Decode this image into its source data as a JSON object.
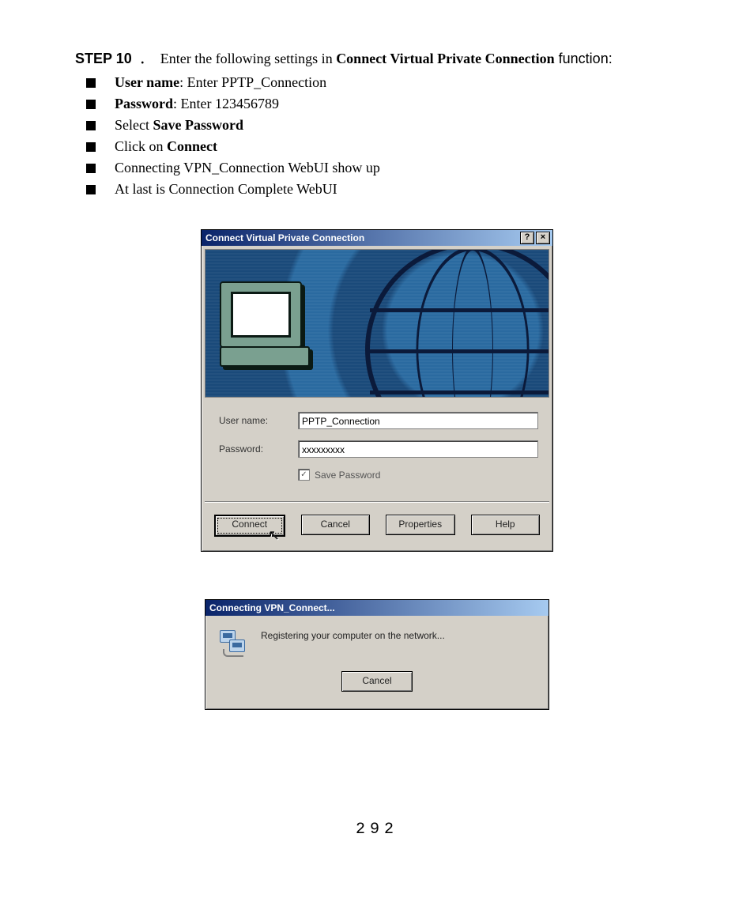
{
  "step": {
    "label": "STEP 10",
    "dot": "﹒",
    "intro_before": "Enter the following settings in ",
    "intro_bold": "Connect Virtual Private Connection",
    "intro_after": " function:"
  },
  "bullets": [
    {
      "pre_bold": "User name",
      "pre_rest": ": Enter PPTP_Connection"
    },
    {
      "pre_bold": "Password",
      "pre_rest": ": Enter 123456789"
    },
    {
      "plain_before": "Select ",
      "bold": "Save Password",
      "plain_after": ""
    },
    {
      "plain_before": "Click on ",
      "bold": "Connect",
      "plain_after": ""
    },
    {
      "plain_before": "Connecting VPN_Connection WebUI show up",
      "bold": "",
      "plain_after": ""
    },
    {
      "plain_before": "At last is Connection Complete WebUI",
      "bold": "",
      "plain_after": ""
    }
  ],
  "dialog1": {
    "title": "Connect Virtual Private Connection",
    "help_btn": "?",
    "close_btn": "×",
    "username_label": "User name:",
    "username_value": "PPTP_Connection",
    "password_label": "Password:",
    "password_value": "xxxxxxxxx",
    "save_pw_label": "Save Password",
    "save_pw_checked": "✓",
    "buttons": {
      "connect": "Connect",
      "cancel": "Cancel",
      "properties": "Properties",
      "help": "Help"
    }
  },
  "dialog2": {
    "title": "Connecting VPN_Connect...",
    "message": "Registering your computer on the network...",
    "cancel": "Cancel"
  },
  "page_number": "292"
}
